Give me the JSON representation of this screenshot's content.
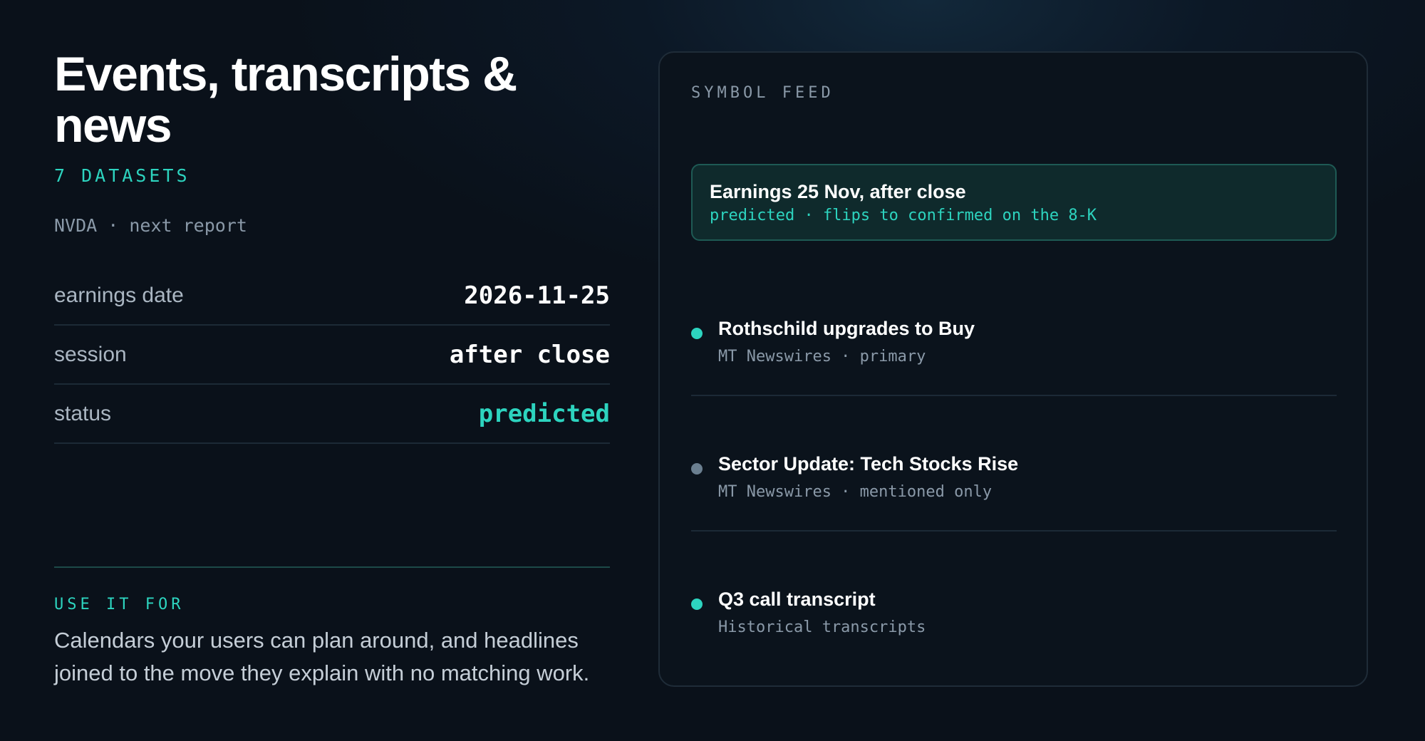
{
  "title": "Events, transcripts & news",
  "dataset_count": "7 DATASETS",
  "report_context": "NVDA · next report",
  "stats": [
    {
      "label": "earnings date",
      "value": "2026-11-25"
    },
    {
      "label": "session",
      "value": "after close"
    },
    {
      "label": "status",
      "value": "predicted"
    }
  ],
  "use_it_for": {
    "heading": "USE IT FOR",
    "body": "Calendars your users can plan around, and headlines joined to the move they explain with no matching work."
  },
  "symbol_feed": {
    "heading": "SYMBOL FEED",
    "highlight": {
      "title": "Earnings 25 Nov, after close",
      "subtitle": "predicted · flips to confirmed on the 8-K"
    },
    "items": [
      {
        "title": "Rothschild upgrades to Buy",
        "meta": "MT Newswires · primary",
        "dot_color": "#2dd4bf"
      },
      {
        "title": "Sector Update: Tech Stocks Rise",
        "meta": "MT Newswires · mentioned only",
        "dot_color": "#6b7f90"
      },
      {
        "title": "Q3 call transcript",
        "meta": "Historical transcripts",
        "dot_color": "#2dd4bf"
      }
    ]
  },
  "colors": {
    "accent": "#2dd4bf",
    "background": "#0a111a",
    "muted_dot": "#6b7f90"
  }
}
